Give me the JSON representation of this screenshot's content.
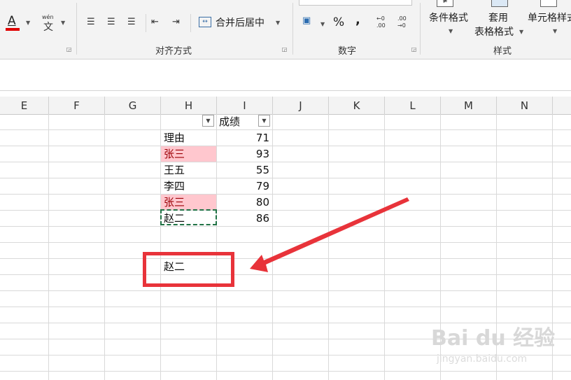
{
  "ribbon": {
    "merge_center_label": "合并后居中",
    "percent_symbol": "%",
    "comma_symbol": ",",
    "inc_decimal_label": "←0 .00",
    "dec_decimal_label": ".00 →0",
    "phonetic_label": "wén",
    "phonetic_char": "文",
    "font_color_letter": "A",
    "font_color_bar": "#e00000",
    "alignment_group_label": "对齐方式",
    "number_group_label": "数字",
    "styles_group_label": "样式",
    "conditional_format_label": "条件格式",
    "table_format_label_1": "套用",
    "table_format_label_2": "表格格式",
    "cell_styles_label": "单元格样式"
  },
  "columns": [
    "E",
    "F",
    "G",
    "H",
    "I",
    "J",
    "K",
    "L",
    "M",
    "N"
  ],
  "table": {
    "header_score": "成绩",
    "rows": [
      {
        "name": "理由",
        "score": "71",
        "highlight": false
      },
      {
        "name": "张三",
        "score": "93",
        "highlight": true
      },
      {
        "name": "王五",
        "score": "55",
        "highlight": false
      },
      {
        "name": "李四",
        "score": "79",
        "highlight": false
      },
      {
        "name": "张三",
        "score": "80",
        "highlight": true
      },
      {
        "name": "赵二",
        "score": "86",
        "highlight": false
      }
    ]
  },
  "result_cell": "赵二",
  "colors": {
    "highlight_fill": "#ffc7ce",
    "highlight_text": "#9c0006",
    "annotation_red": "#e8333a",
    "selection_green": "#217346"
  },
  "watermark": {
    "main": "Bai du 经验",
    "url": "jingyan.baidu.com"
  }
}
